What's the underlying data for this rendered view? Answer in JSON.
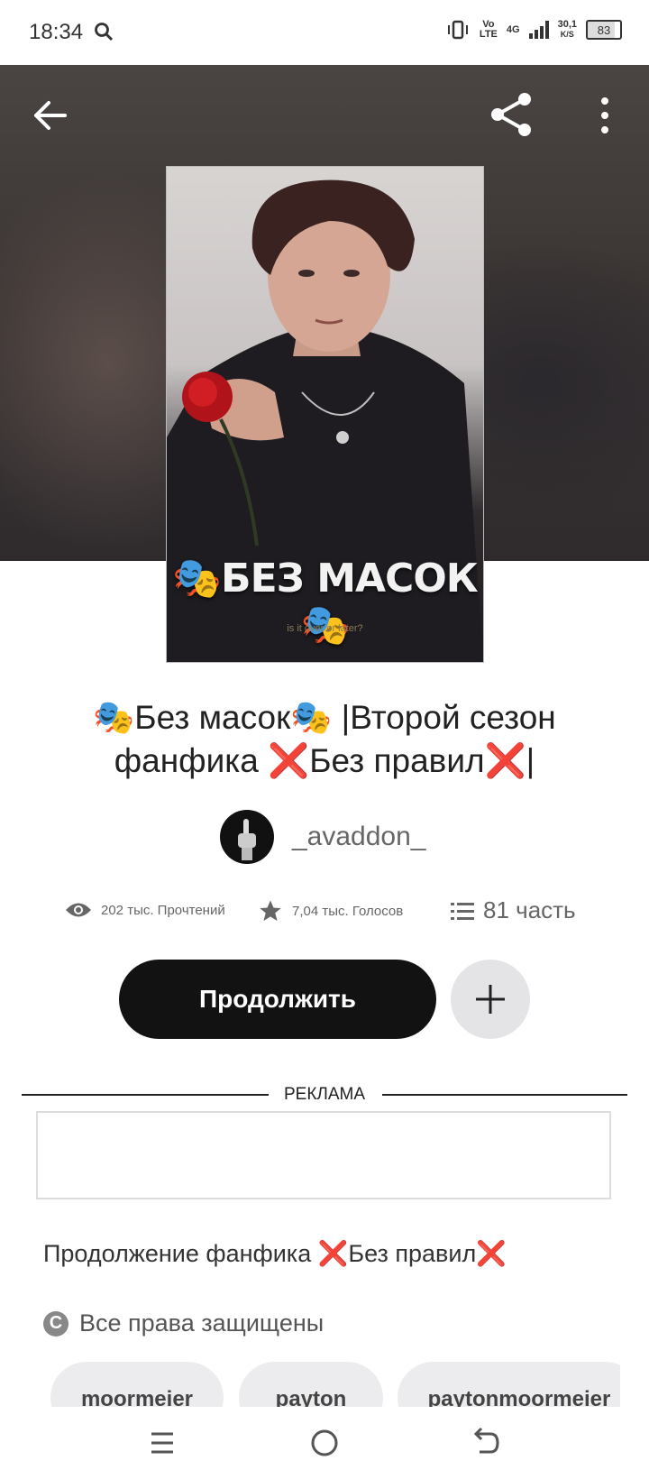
{
  "status_bar": {
    "time": "18:34",
    "net_top": "Vo",
    "net_bottom": "LTE",
    "gen": "4G",
    "speed_top": "30,1",
    "speed_bottom": "K/S",
    "battery": "83"
  },
  "header": {
    "back_icon": "arrow-left-icon",
    "share_icon": "share-icon",
    "more_icon": "more-vertical-icon"
  },
  "cover": {
    "title": "🎭БЕЗ МАСОК🎭",
    "subtitle": "is it over or later?"
  },
  "book": {
    "title": "🎭Без масок🎭 |Второй сезон фанфика ❌Без правил❌|"
  },
  "author": {
    "name": "_avaddon_"
  },
  "stats": {
    "reads": "202 тыс. Прочтений",
    "votes": "7,04 тыс. Голосов",
    "parts": "81 часть"
  },
  "actions": {
    "continue_label": "Продолжить",
    "add_icon": "plus-icon"
  },
  "ad": {
    "label": "РЕКЛАМА"
  },
  "description": {
    "text": "Продолжение фанфика ❌Без правил❌",
    "copyright": "Все права защищены",
    "copyright_symbol": "C"
  },
  "tags": [
    "moormeier",
    "payton",
    "paytonmoormeier"
  ],
  "navbar": {
    "items": [
      "menu-icon",
      "home-icon",
      "back-icon"
    ]
  }
}
